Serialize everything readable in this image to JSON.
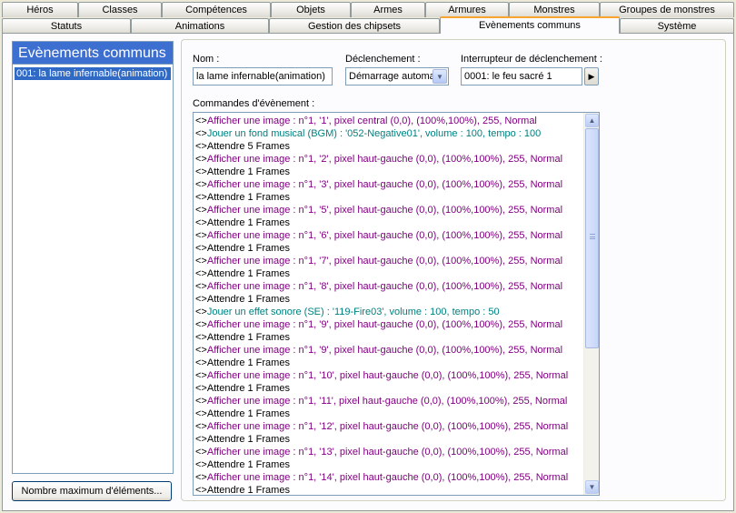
{
  "tabs_row1": [
    "Héros",
    "Classes",
    "Compétences",
    "Objets",
    "Armes",
    "Armures",
    "Monstres",
    "Groupes de monstres"
  ],
  "tabs_row2": [
    "Statuts",
    "Animations",
    "Gestion des chipsets",
    "Evènements communs",
    "Système"
  ],
  "active_tab": "Evènements communs",
  "left_panel": {
    "title": "Evènements communs",
    "items": [
      "001: la lame infernable(animation)"
    ],
    "max_button": "Nombre maximum d'éléments..."
  },
  "form": {
    "name_label": "Nom :",
    "name_value": "la lame infernable(animation)",
    "trigger_label": "Déclenchement :",
    "trigger_value": "Démarrage automa",
    "switch_label": "Interrupteur de déclenchement :",
    "switch_value": "0001: le feu sacré 1",
    "commands_label": "Commandes d'évènement :"
  },
  "colors": {
    "picture": "#800080",
    "audio": "#008080",
    "wait": "#000000",
    "selection": "#316ac5",
    "active_tab_accent": "#f7a530"
  },
  "commands": [
    {
      "prefix": "<>",
      "text": "Afficher une image : n°1, '1', pixel central (0,0), (100%,100%), 255, Normal",
      "kind": "picture"
    },
    {
      "prefix": "<>",
      "text": "Jouer un fond musical (BGM) : '052-Negative01', volume : 100, tempo : 100",
      "kind": "audio"
    },
    {
      "prefix": "<>",
      "text": "Attendre 5 Frames",
      "kind": "wait"
    },
    {
      "prefix": "<>",
      "text": "Afficher une image : n°1, '2', pixel haut-gauche (0,0), (100%,100%), 255, Normal",
      "kind": "picture"
    },
    {
      "prefix": "<>",
      "text": "Attendre 1 Frames",
      "kind": "wait"
    },
    {
      "prefix": "<>",
      "text": "Afficher une image : n°1, '3', pixel haut-gauche (0,0), (100%,100%), 255, Normal",
      "kind": "picture"
    },
    {
      "prefix": "<>",
      "text": "Attendre 1 Frames",
      "kind": "wait"
    },
    {
      "prefix": "<>",
      "text": "Afficher une image : n°1, '5', pixel haut-gauche (0,0), (100%,100%), 255, Normal",
      "kind": "picture"
    },
    {
      "prefix": "<>",
      "text": "Attendre 1 Frames",
      "kind": "wait"
    },
    {
      "prefix": "<>",
      "text": "Afficher une image : n°1, '6', pixel haut-gauche (0,0), (100%,100%), 255, Normal",
      "kind": "picture"
    },
    {
      "prefix": "<>",
      "text": "Attendre 1 Frames",
      "kind": "wait"
    },
    {
      "prefix": "<>",
      "text": "Afficher une image : n°1, '7', pixel haut-gauche (0,0), (100%,100%), 255, Normal",
      "kind": "picture"
    },
    {
      "prefix": "<>",
      "text": "Attendre 1 Frames",
      "kind": "wait"
    },
    {
      "prefix": "<>",
      "text": "Afficher une image : n°1, '8', pixel haut-gauche (0,0), (100%,100%), 255, Normal",
      "kind": "picture"
    },
    {
      "prefix": "<>",
      "text": "Attendre 1 Frames",
      "kind": "wait"
    },
    {
      "prefix": "<>",
      "text": "Jouer un effet sonore (SE) : '119-Fire03', volume : 100, tempo : 50",
      "kind": "audio"
    },
    {
      "prefix": "<>",
      "text": "Afficher une image : n°1, '9', pixel haut-gauche (0,0), (100%,100%), 255, Normal",
      "kind": "picture"
    },
    {
      "prefix": "<>",
      "text": "Attendre 1 Frames",
      "kind": "wait"
    },
    {
      "prefix": "<>",
      "text": "Afficher une image : n°1, '9', pixel haut-gauche (0,0), (100%,100%), 255, Normal",
      "kind": "picture"
    },
    {
      "prefix": "<>",
      "text": "Attendre 1 Frames",
      "kind": "wait"
    },
    {
      "prefix": "<>",
      "text": "Afficher une image : n°1, '10', pixel haut-gauche (0,0), (100%,100%), 255, Normal",
      "kind": "picture"
    },
    {
      "prefix": "<>",
      "text": "Attendre 1 Frames",
      "kind": "wait"
    },
    {
      "prefix": "<>",
      "text": "Afficher une image : n°1, '11', pixel haut-gauche (0,0), (100%,100%), 255, Normal",
      "kind": "picture"
    },
    {
      "prefix": "<>",
      "text": "Attendre 1 Frames",
      "kind": "wait"
    },
    {
      "prefix": "<>",
      "text": "Afficher une image : n°1, '12', pixel haut-gauche (0,0), (100%,100%), 255, Normal",
      "kind": "picture"
    },
    {
      "prefix": "<>",
      "text": "Attendre 1 Frames",
      "kind": "wait"
    },
    {
      "prefix": "<>",
      "text": "Afficher une image : n°1, '13', pixel haut-gauche (0,0), (100%,100%), 255, Normal",
      "kind": "picture"
    },
    {
      "prefix": "<>",
      "text": "Attendre 1 Frames",
      "kind": "wait"
    },
    {
      "prefix": "<>",
      "text": "Afficher une image : n°1, '14', pixel haut-gauche (0,0), (100%,100%), 255, Normal",
      "kind": "picture"
    },
    {
      "prefix": "<>",
      "text": "Attendre 1 Frames",
      "kind": "wait"
    }
  ]
}
